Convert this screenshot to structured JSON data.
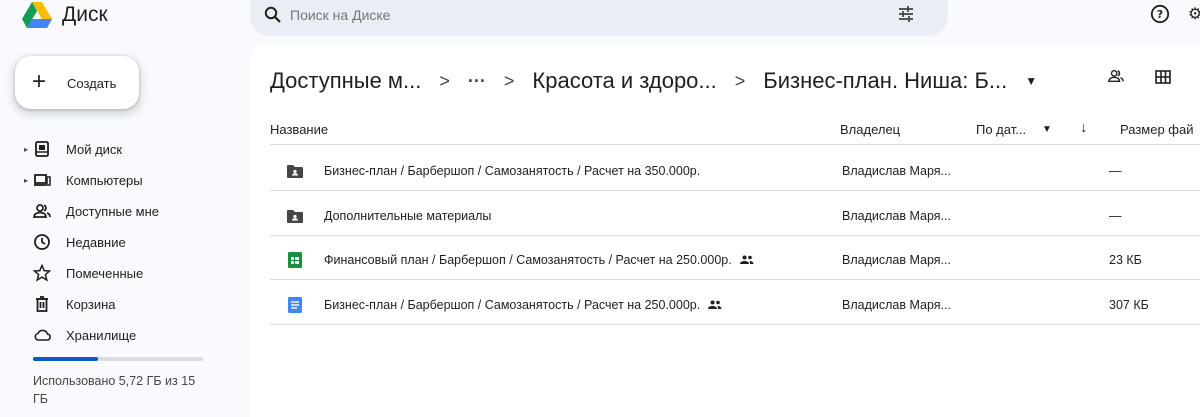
{
  "app": {
    "name": "Диск"
  },
  "search": {
    "placeholder": "Поиск на Диске"
  },
  "sidebar": {
    "create_label": "Создать",
    "items": [
      {
        "label": "Мой диск",
        "icon": "my-drive-icon",
        "expandable": true
      },
      {
        "label": "Компьютеры",
        "icon": "computers-icon",
        "expandable": true
      },
      {
        "label": "Доступные мне",
        "icon": "shared-with-me-icon",
        "expandable": false
      },
      {
        "label": "Недавние",
        "icon": "clock-icon",
        "expandable": false
      },
      {
        "label": "Помеченные",
        "icon": "star-icon",
        "expandable": false
      },
      {
        "label": "Корзина",
        "icon": "trash-icon",
        "expandable": false
      },
      {
        "label": "Хранилище",
        "icon": "cloud-icon",
        "expandable": false
      }
    ],
    "storage": {
      "used_fraction": 0.381,
      "text": "Использовано 5,72 ГБ из 15 ГБ"
    }
  },
  "breadcrumb": {
    "root": "Доступные м...",
    "middle": "Красота и здоро...",
    "current": "Бизнес-план. Ниша: Б..."
  },
  "table": {
    "headers": {
      "name": "Название",
      "owner": "Владелец",
      "sort": "По дат...",
      "size": "Размер фай"
    },
    "rows": [
      {
        "name": "Бизнес-план / Барбершоп / Самозанятость / Расчет на 350.000р.",
        "type": "folder",
        "shared": false,
        "owner": "Владислав Маря...",
        "size": "—"
      },
      {
        "name": "Дополнительные материалы",
        "type": "folder",
        "shared": false,
        "owner": "Владислав Маря...",
        "size": "—"
      },
      {
        "name": "Финансовый план / Барбершоп / Самозанятость / Расчет на 250.000р.",
        "type": "sheets",
        "shared": true,
        "owner": "Владислав Маря...",
        "size": "23 КБ"
      },
      {
        "name": "Бизнес-план / Барбершоп / Самозанятость / Расчет на 250.000р.",
        "type": "docs",
        "shared": true,
        "owner": "Владислав Маря...",
        "size": "307 КБ"
      }
    ]
  },
  "colors": {
    "accent": "#0b57d0",
    "sheets": "#1e8e3e",
    "docs": "#4285f4",
    "folder": "#444746"
  }
}
